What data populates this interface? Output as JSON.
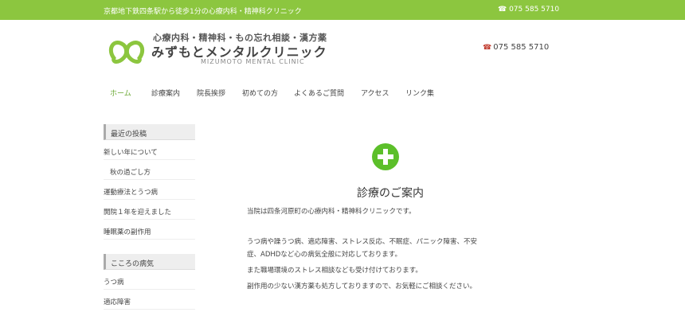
{
  "topbar": {
    "tagline": "京都地下鉄四条駅から徒歩1分の心療内科・精神科クリニック",
    "tel": "075 585 5710"
  },
  "header": {
    "sub_title": "心療内科・精神科・もの忘れ相談・漢方薬",
    "title": "みずもとメンタルクリニック",
    "en_title": "MIZUMOTO MENTAL CLINIC",
    "tel": "075 585 5710"
  },
  "nav": [
    {
      "label": "ホーム"
    },
    {
      "label": "診療案内"
    },
    {
      "label": "院長挨拶"
    },
    {
      "label": "初めての方"
    },
    {
      "label": "よくあるご質問"
    },
    {
      "label": "アクセス"
    },
    {
      "label": "リンク集"
    }
  ],
  "sidebar": {
    "section1_title": "最近の投稿",
    "section1_items": [
      {
        "label": "新しい年について"
      },
      {
        "label": "秋の過ごし方"
      },
      {
        "label": "運動療法とうつ病"
      },
      {
        "label": "開院１年を迎えました"
      },
      {
        "label": "睡眠薬の副作用"
      }
    ],
    "section2_title": "こころの病気",
    "section2_items": [
      {
        "label": "うつ病"
      },
      {
        "label": "適応障害"
      }
    ]
  },
  "content": {
    "heading": "診療のご案内",
    "p1": "当院は四条河原町の心療内科・精神科クリニックです。",
    "p2a": "うつ病や躁うつ病、適応障害、ストレス反応、不眠症、パニック障害、不安",
    "p2b": "症、ADHDなど心の病気全般に対応しております。",
    "p3": "また職場環境のストレス相談なども受け付けております。",
    "p4": "副作用の少ない漢方薬も処方しておりますので、お気軽にご相談ください。"
  },
  "colors": {
    "brand_green": "#8cc63f",
    "icon_green": "#5cbf2a",
    "phone_red": "#c0392b"
  }
}
